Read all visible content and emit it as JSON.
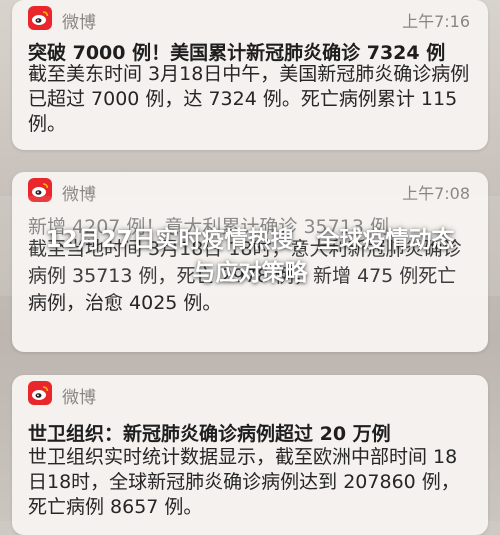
{
  "notifications": [
    {
      "app": "微博",
      "time": "上午7:16",
      "title": "突破 7000 例！美国累计新冠肺炎确诊 7324 例",
      "body": "截至美东时间 3月18日中午，美国新冠肺炎确诊病例已超过 7000 例，达 7324 例。死亡病例累计 115 例。"
    },
    {
      "app": "微博",
      "time": "上午7:08",
      "title": "新增 4207 例！意大利累计确诊 35713 例",
      "body": "截至当地时间 3月18日 18时，意大利新冠肺炎确诊病例 35713 例，死亡 2978 例，新增 475 例死亡病例，治愈 4025 例。"
    },
    {
      "app": "微博",
      "time": "",
      "title": "世卫组织：新冠肺炎确诊病例超过 20 万例",
      "body": "世卫组织实时统计数据显示，截至欧洲中部时间 18日18时，全球新冠肺炎确诊病例达到 207860 例，死亡病例 8657 例。"
    }
  ],
  "overlay": {
    "headline": "12月27日实时疫情热搜，全球疫情动态与应对策略"
  },
  "colors": {
    "weibo_red": "#e8262b",
    "card_bg": "#f4f1ee",
    "time_gray": "#8a8683"
  },
  "icons": {
    "app_icon": "weibo-logo-icon"
  }
}
